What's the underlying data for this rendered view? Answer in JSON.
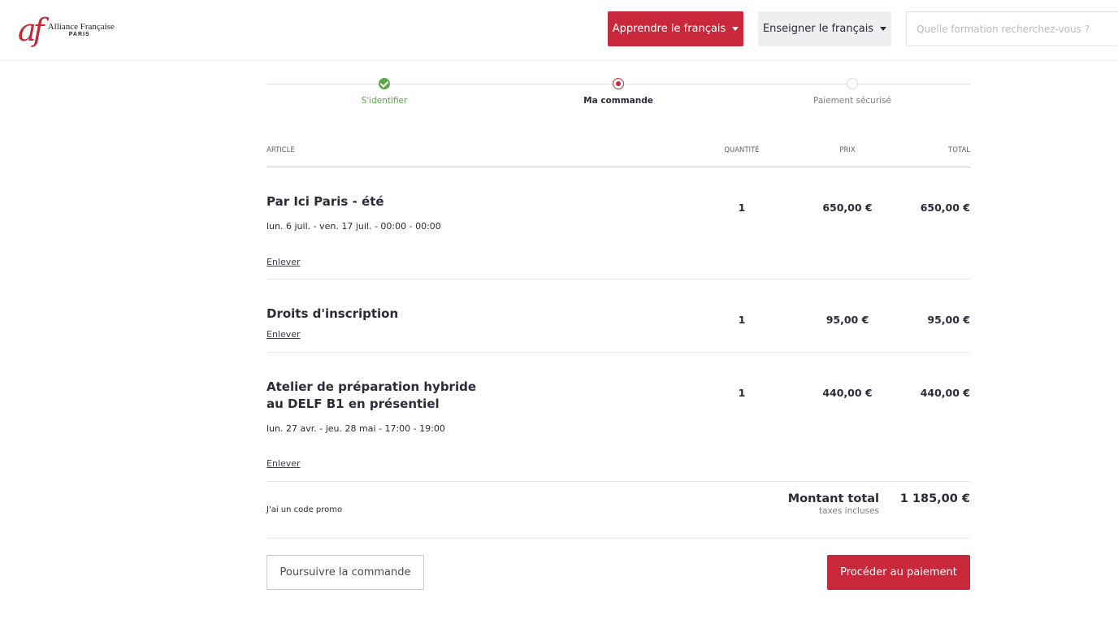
{
  "brand": {
    "mark": "af",
    "name": "Alliance Française",
    "city": "PARIS",
    "accent_color": "#c8283a"
  },
  "nav": {
    "learn_label": "Apprendre le français",
    "teach_label": "Enseigner le français",
    "search_placeholder": "Quelle formation recherchez-vous ?"
  },
  "stepper": {
    "steps": [
      {
        "label": "S'identifier",
        "state": "done"
      },
      {
        "label": "Ma commande",
        "state": "active"
      },
      {
        "label": "Paiement sécurisé",
        "state": "todo"
      }
    ]
  },
  "cart": {
    "headers": {
      "article": "ARTICLE",
      "quantity": "QUANTITÉ",
      "price": "PRIX",
      "total": "TOTAL"
    },
    "items": [
      {
        "title": "Par Ici Paris - été",
        "date": "lun. 6 juil. - ven. 17 juil. - 00:00 - 00:00",
        "quantity": "1",
        "price": "650,00 €",
        "total": "650,00 €",
        "remove_label": "Enlever"
      },
      {
        "title": "Droits d'inscription",
        "date": "",
        "quantity": "1",
        "price": "95,00 €",
        "total": "95,00 €",
        "remove_label": "Enlever"
      },
      {
        "title": "Atelier de préparation hybride au DELF B1 en présentiel",
        "date": "lun. 27 avr. - jeu. 28 mai - 17:00 - 19:00",
        "quantity": "1",
        "price": "440,00 €",
        "total": "440,00 €",
        "remove_label": "Enlever"
      }
    ],
    "promo_label": "J'ai un code promo",
    "total_label": "Montant total",
    "taxes_label": "taxes incluses",
    "total_value": "1 185,00 €"
  },
  "actions": {
    "continue_label": "Poursuivre la commande",
    "pay_label": "Procéder au paiement"
  }
}
